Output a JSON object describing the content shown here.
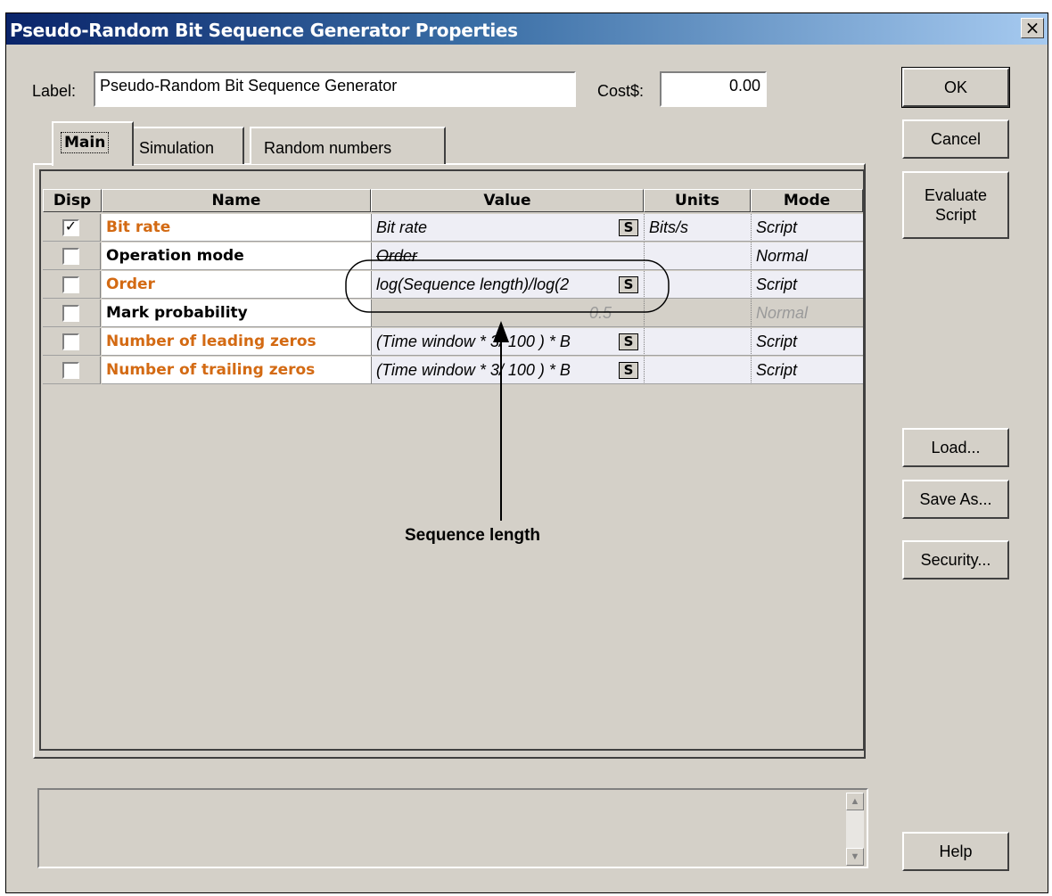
{
  "window": {
    "title": "Pseudo-Random Bit Sequence Generator Properties",
    "close_label": "×"
  },
  "label_field": {
    "label": "Label:",
    "value": "Pseudo-Random Bit Sequence Generator"
  },
  "cost_field": {
    "label": "Cost$:",
    "value": "0.00"
  },
  "tabs": [
    {
      "label": "Main",
      "active": true
    },
    {
      "label": "Simulation",
      "active": false
    },
    {
      "label": "Random numbers",
      "active": false
    }
  ],
  "table": {
    "columns": [
      "Disp",
      "Name",
      "Value",
      "Units",
      "Mode"
    ],
    "rows": [
      {
        "disp": "✓",
        "name": "Bit rate",
        "value": "Bit rate",
        "units": "Bits/s",
        "mode": "Script"
      },
      {
        "disp": "",
        "name": "Operation mode",
        "value": "Order",
        "units": "",
        "mode": "Normal"
      },
      {
        "disp": "",
        "name": "Order",
        "value": "log(Sequence length)/log(2",
        "units": "",
        "mode": "Script"
      },
      {
        "disp": "",
        "name": "Mark probability",
        "value": "0.5",
        "units": "",
        "mode": "Normal"
      },
      {
        "disp": "",
        "name": "Number of leading zeros",
        "value": "(Time window * 3/ 100 ) * B",
        "units": "",
        "mode": "Script"
      },
      {
        "disp": "",
        "name": "Number of trailing zeros",
        "value": "(Time window * 3/ 100 ) * B",
        "units": "",
        "mode": "Script"
      }
    ],
    "script_button": "S"
  },
  "buttons": {
    "ok": "OK",
    "cancel": "Cancel",
    "evaluate": "Evaluate Script",
    "load": "Load...",
    "save_as": "Save As...",
    "security": "Security...",
    "help": "Help"
  },
  "annotation": {
    "text": "Sequence length"
  },
  "colors": {
    "title_bar": "#0a246a",
    "script_param": "#d36a13",
    "dialog_bg": "#d4d0c8"
  }
}
